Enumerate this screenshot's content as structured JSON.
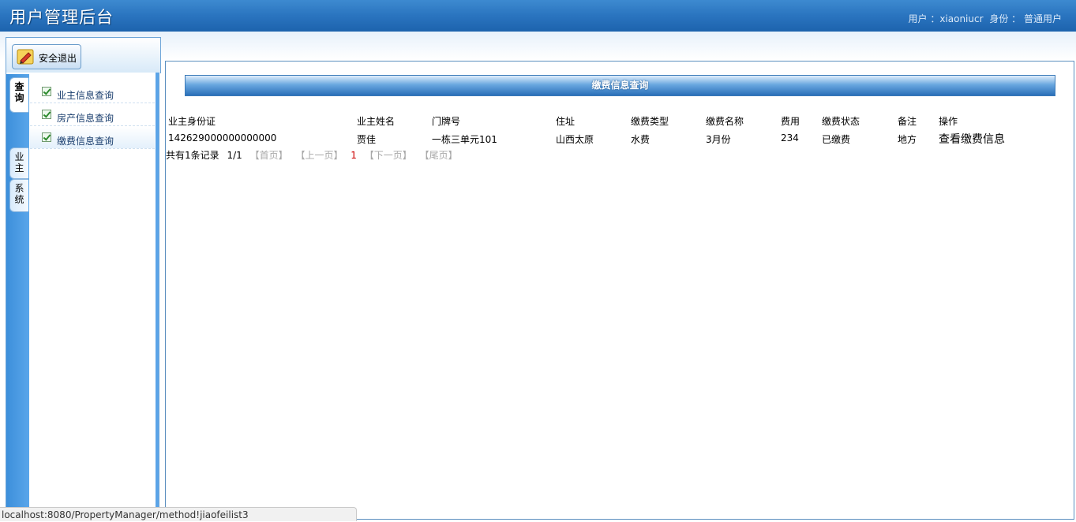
{
  "header": {
    "title": "用户管理后台",
    "user_label": "用户 ：xiaoniucr",
    "role_label": "身份 ： 普通用户"
  },
  "sidebar": {
    "logout_label": "安全退出",
    "tabs": [
      {
        "label": "查询",
        "chars": [
          "查",
          "询"
        ]
      },
      {
        "label": "业主",
        "chars": [
          "业",
          "主"
        ]
      },
      {
        "label": "系统",
        "chars": [
          "系",
          "统"
        ]
      }
    ],
    "menu": [
      {
        "label": "业主信息查询"
      },
      {
        "label": "房产信息查询"
      },
      {
        "label": "缴费信息查询",
        "selected": true
      }
    ]
  },
  "main": {
    "panel_title": "缴费信息查询",
    "columns": [
      "业主身份证",
      "业主姓名",
      "门牌号",
      "住址",
      "缴费类型",
      "缴费名称",
      "费用",
      "缴费状态",
      "备注",
      "操作"
    ],
    "rows": [
      {
        "id_card": "142629000000000000",
        "name": "贾佳",
        "door_no": "一栋三单元101",
        "address": "山西太原",
        "type": "水费",
        "fee_name": "3月份",
        "cost": "234",
        "status": "已缴费",
        "remark": "地方",
        "action": "查看缴费信息"
      }
    ],
    "pager": {
      "total_text": "共有1条记录",
      "page_text": "1/1",
      "first": "【首页】",
      "prev": "【上一页】",
      "current": "1",
      "next": "【下一页】",
      "last": "【尾页】"
    }
  },
  "statusbar": {
    "url": "localhost:8080/PropertyManager/method!jiaofeilist3"
  },
  "colors": {
    "header_blue": "#2a74bf",
    "accent_light": "#5ba4e8",
    "current_page": "#cc0000"
  }
}
